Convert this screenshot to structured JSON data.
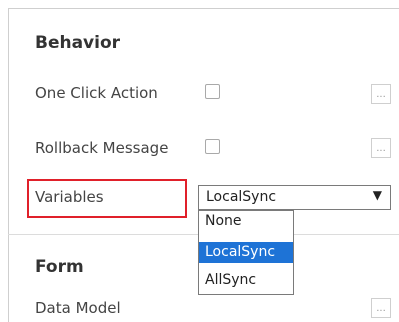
{
  "behavior": {
    "title": "Behavior",
    "rows": [
      {
        "label": "One Click Action",
        "checked": false,
        "ellipsis": "..."
      },
      {
        "label": "Rollback Message",
        "checked": false,
        "ellipsis": "..."
      }
    ],
    "variables": {
      "label": "Variables",
      "selected": "LocalSync",
      "options": [
        "None",
        "LocalSync",
        "AllSync"
      ]
    }
  },
  "form": {
    "title": "Form",
    "rows": [
      {
        "label": "Data Model",
        "ellipsis": "..."
      }
    ]
  },
  "colors": {
    "highlight": "#e0202a",
    "selection": "#1e73d6"
  },
  "icons": {
    "dropdown": "▼"
  }
}
